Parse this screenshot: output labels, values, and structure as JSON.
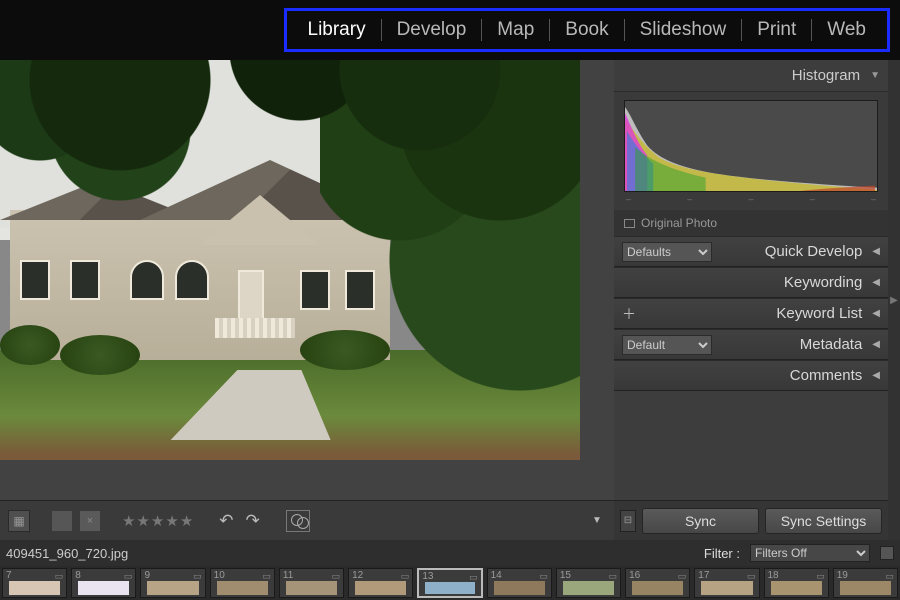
{
  "modules": {
    "items": [
      "Library",
      "Develop",
      "Map",
      "Book",
      "Slideshow",
      "Print",
      "Web"
    ],
    "active": "Library"
  },
  "histogram": {
    "label": "Histogram",
    "original_label": "Original Photo"
  },
  "panels": {
    "quick_develop": {
      "label": "Quick Develop",
      "preset_label": "Defaults"
    },
    "keywording": {
      "label": "Keywording"
    },
    "keyword_list": {
      "label": "Keyword List"
    },
    "metadata": {
      "label": "Metadata",
      "preset_label": "Default"
    },
    "comments": {
      "label": "Comments"
    }
  },
  "sync": {
    "sync_label": "Sync",
    "sync_settings_label": "Sync Settings"
  },
  "status": {
    "filename": "409451_960_720.jpg",
    "filter_label": "Filter :",
    "filter_value": "Filters Off"
  },
  "toolbar": {
    "star_count": 5
  },
  "filmstrip": {
    "start_index": 7,
    "count": 13,
    "selected_index": 13,
    "thumb_colors": [
      "#d8c6b4",
      "#e9e4ef",
      "#b7a487",
      "#a08c6f",
      "#a59478",
      "#b09a79",
      "#8fb0c9",
      "#8e795c",
      "#9aa77d",
      "#978463",
      "#b6a383",
      "#a8946f",
      "#9c8867"
    ]
  }
}
